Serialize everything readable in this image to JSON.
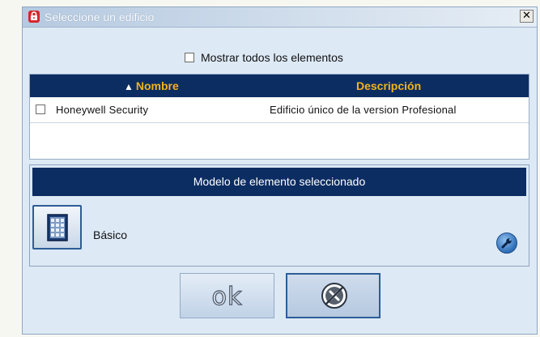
{
  "window": {
    "title": "Seleccione un edificio",
    "close_glyph": "✕"
  },
  "icons": {
    "title": "lock-icon",
    "close": "close-icon",
    "building": "building-icon",
    "wrench": "wrench-icon",
    "cancel": "cancel-icon"
  },
  "colors": {
    "header_bg": "#0c2d62",
    "header_text": "#f2b41b",
    "dialog_bg": "#dde9f5",
    "title_icon": "#d5282b"
  },
  "filter": {
    "show_all_label": "Mostrar todos los elementos",
    "show_all_checked": false
  },
  "grid": {
    "columns": [
      {
        "label": "Nombre",
        "sorted": "ascending",
        "sort_glyph": "▲"
      },
      {
        "label": "Descripción"
      }
    ],
    "rows": [
      {
        "checked": false,
        "name": "Honeywell Security",
        "description": "Edificio único de la version Profesional"
      }
    ]
  },
  "model": {
    "header": "Modelo de elemento seleccionado",
    "selected_label": "Básico"
  },
  "buttons": {
    "ok_label": "ok"
  }
}
